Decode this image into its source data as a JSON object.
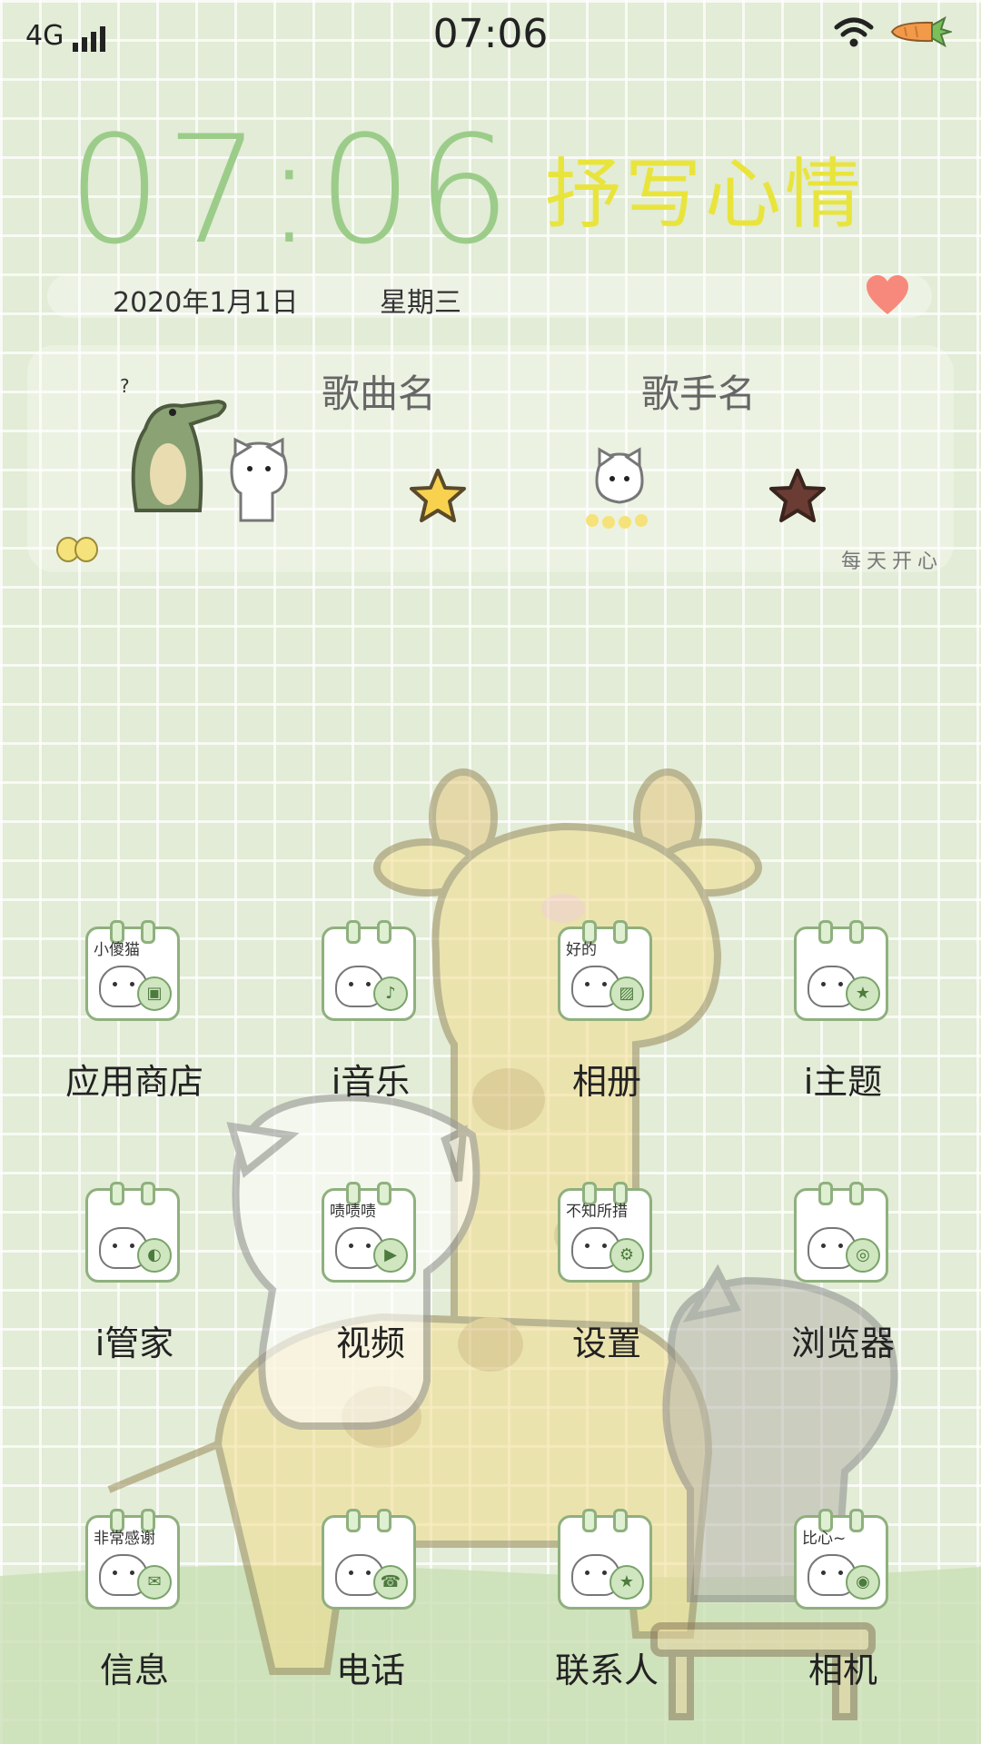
{
  "status_bar": {
    "network": "4G",
    "time": "07:06",
    "icons": [
      "signal-icon",
      "wifi-icon",
      "carrot-battery-icon"
    ]
  },
  "clock_widget": {
    "time": "07:06",
    "title": "抒写心情",
    "date": "2020年1月1日",
    "weekday": "星期三"
  },
  "music_widget": {
    "song": "歌曲名",
    "singer": "歌手名",
    "tagline": "每天开心",
    "icons": [
      "prev-star-icon",
      "next-star-icon"
    ]
  },
  "apps": [
    {
      "label": "应用商店",
      "icon": "app-store-icon",
      "icon_text": "小傻猫",
      "badge": "▣"
    },
    {
      "label": "i音乐",
      "icon": "music-icon",
      "icon_text": "",
      "badge": "♪"
    },
    {
      "label": "相册",
      "icon": "album-icon",
      "icon_text": "好的",
      "badge": "▨"
    },
    {
      "label": "i主题",
      "icon": "theme-icon",
      "icon_text": "",
      "badge": "★"
    },
    {
      "label": "i管家",
      "icon": "manager-icon",
      "icon_text": "",
      "badge": "◐"
    },
    {
      "label": "视频",
      "icon": "video-icon",
      "icon_text": "啧啧啧",
      "badge": "▶"
    },
    {
      "label": "设置",
      "icon": "settings-icon",
      "icon_text": "不知所措",
      "badge": "⚙"
    },
    {
      "label": "浏览器",
      "icon": "browser-icon",
      "icon_text": "",
      "badge": "◎"
    },
    {
      "label": "信息",
      "icon": "message-icon",
      "icon_text": "非常感谢",
      "badge": "✉"
    },
    {
      "label": "电话",
      "icon": "phone-icon",
      "icon_text": "",
      "badge": "☎"
    },
    {
      "label": "联系人",
      "icon": "contacts-icon",
      "icon_text": "",
      "badge": "★"
    },
    {
      "label": "相机",
      "icon": "camera-icon",
      "icon_text": "比心~",
      "badge": "◉"
    }
  ],
  "colors": {
    "background": "#e2ecd6",
    "clock": "#9ccc8a",
    "title": "#e9e43c",
    "icon_border": "#8fb07e"
  }
}
